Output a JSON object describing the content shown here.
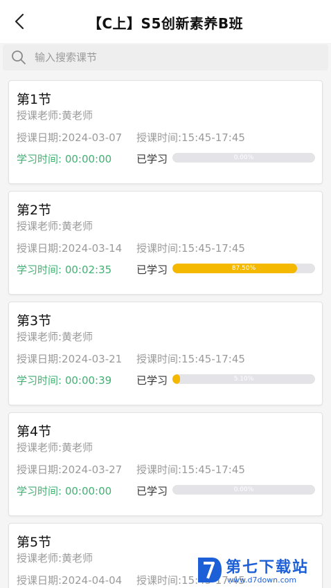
{
  "header": {
    "title": "【C上】S5创新素养B班",
    "back_icon": "chevron-left-icon"
  },
  "search": {
    "placeholder": "输入搜索课节",
    "value": "",
    "icon": "search-icon"
  },
  "lessons": [
    {
      "title": "第1节",
      "teacher": "授课老师:黄老师",
      "date": "授课日期:2024-03-07",
      "time": "授课时间:15:45-17:45",
      "study_time": "学习时间: 00:00:00",
      "learned_label": "已学习",
      "progress": 0.0,
      "progress_text": "0.00%"
    },
    {
      "title": "第2节",
      "teacher": "授课老师:黄老师",
      "date": "授课日期:2024-03-14",
      "time": "授课时间:15:45-17:45",
      "study_time": "学习时间: 00:02:35",
      "learned_label": "已学习",
      "progress": 87.5,
      "progress_text": "87.50%"
    },
    {
      "title": "第3节",
      "teacher": "授课老师:黄老师",
      "date": "授课日期:2024-03-21",
      "time": "授课时间:15:45-17:45",
      "study_time": "学习时间: 00:00:39",
      "learned_label": "已学习",
      "progress": 5.1,
      "progress_text": "5.10%"
    },
    {
      "title": "第4节",
      "teacher": "授课老师:黄老师",
      "date": "授课日期:2024-03-27",
      "time": "授课时间:15:45-17:45",
      "study_time": "学习时间: 00:00:00",
      "learned_label": "已学习",
      "progress": 0.0,
      "progress_text": "0.00%"
    },
    {
      "title": "第5节",
      "teacher": "授课老师:黄老师",
      "date": "授课日期:2024-04-04",
      "time": "授课时间:15:45-17:45"
    }
  ],
  "watermark": {
    "name": "第七下载站",
    "url": "www.d7down.com"
  },
  "colors": {
    "accent_progress": "#f5b800",
    "study_time": "#3cb371",
    "track": "#e3e3e8",
    "watermark": "#1d5fd6"
  }
}
